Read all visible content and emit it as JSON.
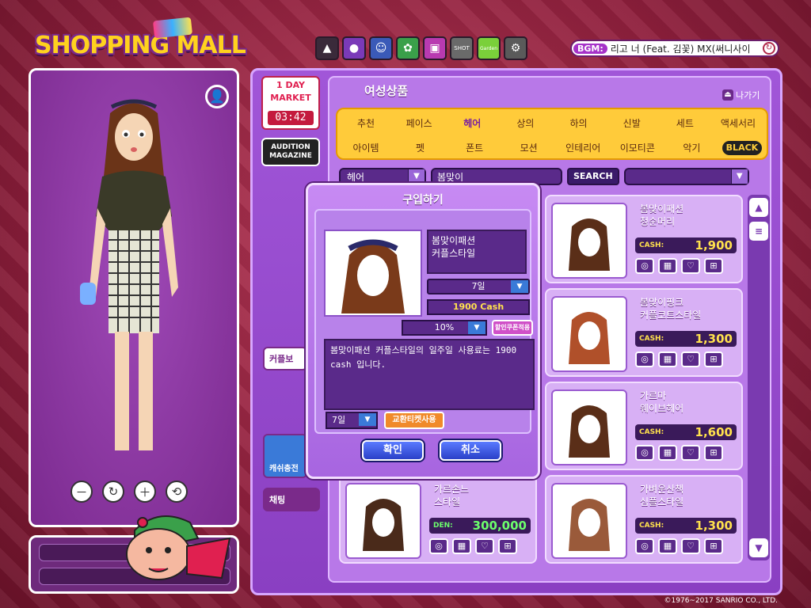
{
  "logo": {
    "text": "SHOPPING MALL"
  },
  "toolbar": {
    "icons": [
      "cart-icon",
      "ghost-icon",
      "smile-icon",
      "cat-icon",
      "tv-icon",
      "shot-icon",
      "garden-icon",
      "gear-icon"
    ],
    "shot_label": "SHOT",
    "garden_label": "Garden"
  },
  "bgm": {
    "label": "BGM:",
    "song": "리고 너 (Feat. 김꽃)   MX(써니사이",
    "button": "↻"
  },
  "oneday": {
    "line1": "1 DAY",
    "line2": "MARKET",
    "timer": "03:42"
  },
  "magazine": {
    "line1": "AUDITION",
    "line2": "MAGAZINE"
  },
  "section": {
    "title": "여성상품",
    "back_label": "나가기"
  },
  "categories": {
    "row1": [
      "추천",
      "페이스",
      "헤어",
      "상의",
      "하의",
      "신발",
      "세트",
      "액세서리"
    ],
    "row2": [
      "아이템",
      "펫",
      "폰트",
      "모션",
      "인테리어",
      "이모티콘",
      "악기",
      "BLACK"
    ],
    "active": "헤어"
  },
  "filter": {
    "category": "헤어",
    "search_value": "봄맞이",
    "search_button": "SEARCH",
    "sort": ""
  },
  "items": [
    {
      "name": "봄맞이패션\n청순머리",
      "currency": "CASH:",
      "price": "1,900"
    },
    {
      "name": "봄맞이핑크\n커플코트스타일",
      "currency": "CASH:",
      "price": "1,300"
    },
    {
      "name": "가르마\n웨이브헤어",
      "currency": "CASH:",
      "price": "1,600"
    },
    {
      "name": "가르손느\n스타일",
      "currency": "DEN:",
      "price": "300,000"
    },
    {
      "name": "가벼운산책\n심플스타일",
      "currency": "CASH:",
      "price": "1,300"
    }
  ],
  "side_buttons": {
    "couple": "커플보",
    "cash": "캐쉬충전",
    "chat": "채팅"
  },
  "dialog": {
    "title": "구입하기",
    "item_name": "봄맞이패션\n커플스타일",
    "period": "7일",
    "cost": "1900 Cash",
    "discount": "10%",
    "coupon": "할인쿠폰적용",
    "description": "봄맞이패션 커플스타일의 일주일 사용료는 1900 cash 입니다.",
    "ticket_period": "7일",
    "ticket_button": "교환티켓사용",
    "ok": "확인",
    "cancel": "취소"
  },
  "copyright": "©1976~2017 SANRIO CO., LTD."
}
